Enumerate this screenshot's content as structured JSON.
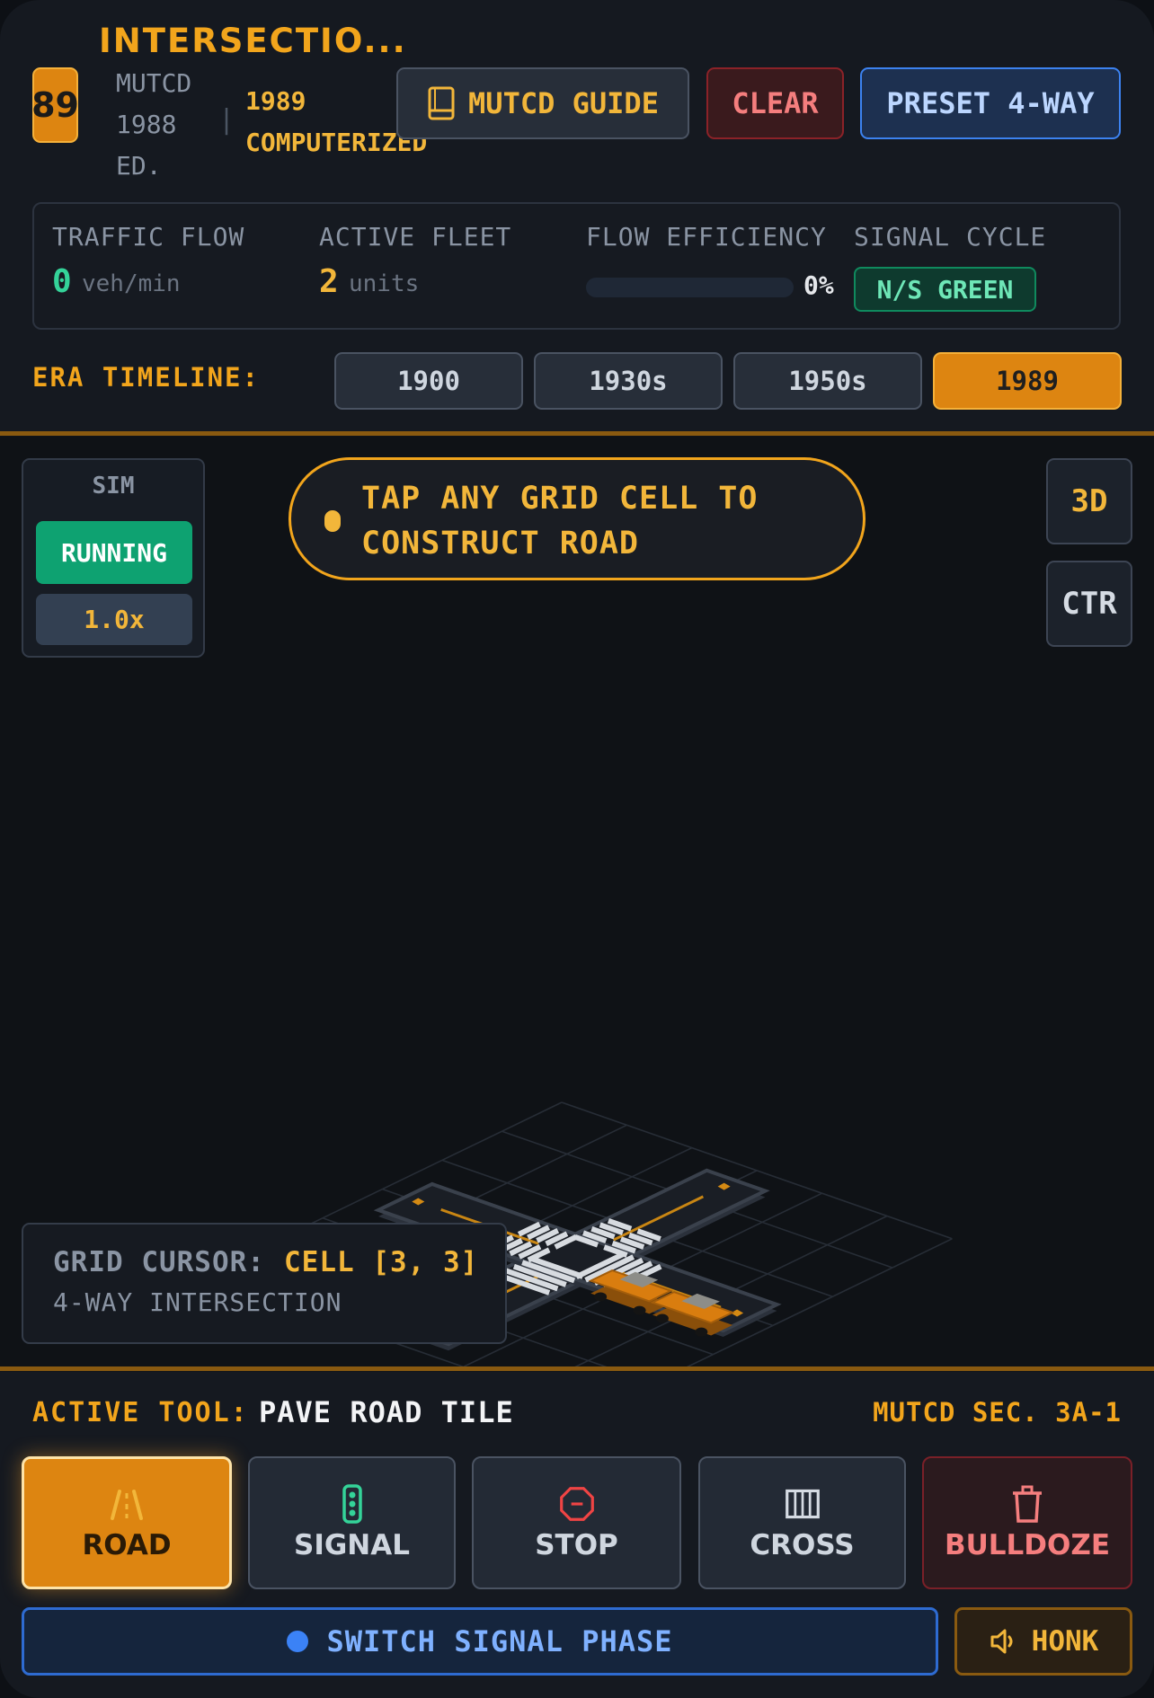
{
  "header": {
    "title": "INTERSECTIO...",
    "year_badge": "89",
    "edition": "MUTCD 1988 ED.",
    "separator": "|",
    "system": "1989 COMPUTERIZED",
    "buttons": {
      "guide": "MUTCD GUIDE",
      "clear": "CLEAR",
      "preset": "PRESET 4-WAY"
    }
  },
  "stats": {
    "traffic_flow": {
      "label": "TRAFFIC FLOW",
      "value": "0",
      "unit": "veh/min"
    },
    "active_fleet": {
      "label": "ACTIVE FLEET",
      "value": "2",
      "unit": "units"
    },
    "flow_efficiency": {
      "label": "FLOW EFFICIENCY",
      "percent_text": "0%",
      "fraction": 0
    },
    "signal_cycle": {
      "label": "SIGNAL CYCLE",
      "value": "N/S GREEN"
    }
  },
  "era": {
    "label": "ERA TIMELINE:",
    "options": [
      "1900",
      "1930s",
      "1950s",
      "1989"
    ],
    "active": "1989"
  },
  "viewport": {
    "sim": {
      "title": "SIM",
      "status": "RUNNING",
      "speed": "1.0x"
    },
    "hint": "TAP ANY GRID CELL TO CONSTRUCT ROAD",
    "view_buttons": {
      "three_d": "3D",
      "center": "CTR"
    },
    "cursor": {
      "label": "GRID CURSOR:",
      "cell": "CELL [3, 3]",
      "description": "4-WAY INTERSECTION"
    }
  },
  "toolbar": {
    "active_label": "ACTIVE TOOL:",
    "active_name": "PAVE ROAD TILE",
    "section": "MUTCD SEC. 3A-1",
    "tools": [
      {
        "id": "road",
        "label": "ROAD",
        "icon": "road-icon"
      },
      {
        "id": "signal",
        "label": "SIGNAL",
        "icon": "traffic-light-icon"
      },
      {
        "id": "stop",
        "label": "STOP",
        "icon": "stop-sign-icon"
      },
      {
        "id": "cross",
        "label": "CROSS",
        "icon": "crosswalk-icon"
      },
      {
        "id": "bulldoze",
        "label": "BULLDOZE",
        "icon": "trash-icon"
      }
    ],
    "switch_phase": "SWITCH SIGNAL PHASE",
    "honk": "HONK"
  },
  "colors": {
    "accent": "#f2a51c",
    "accent_fill": "#dd8511",
    "green": "#0ea271",
    "danger": "#f57e7e",
    "blue": "#3c82f0"
  }
}
